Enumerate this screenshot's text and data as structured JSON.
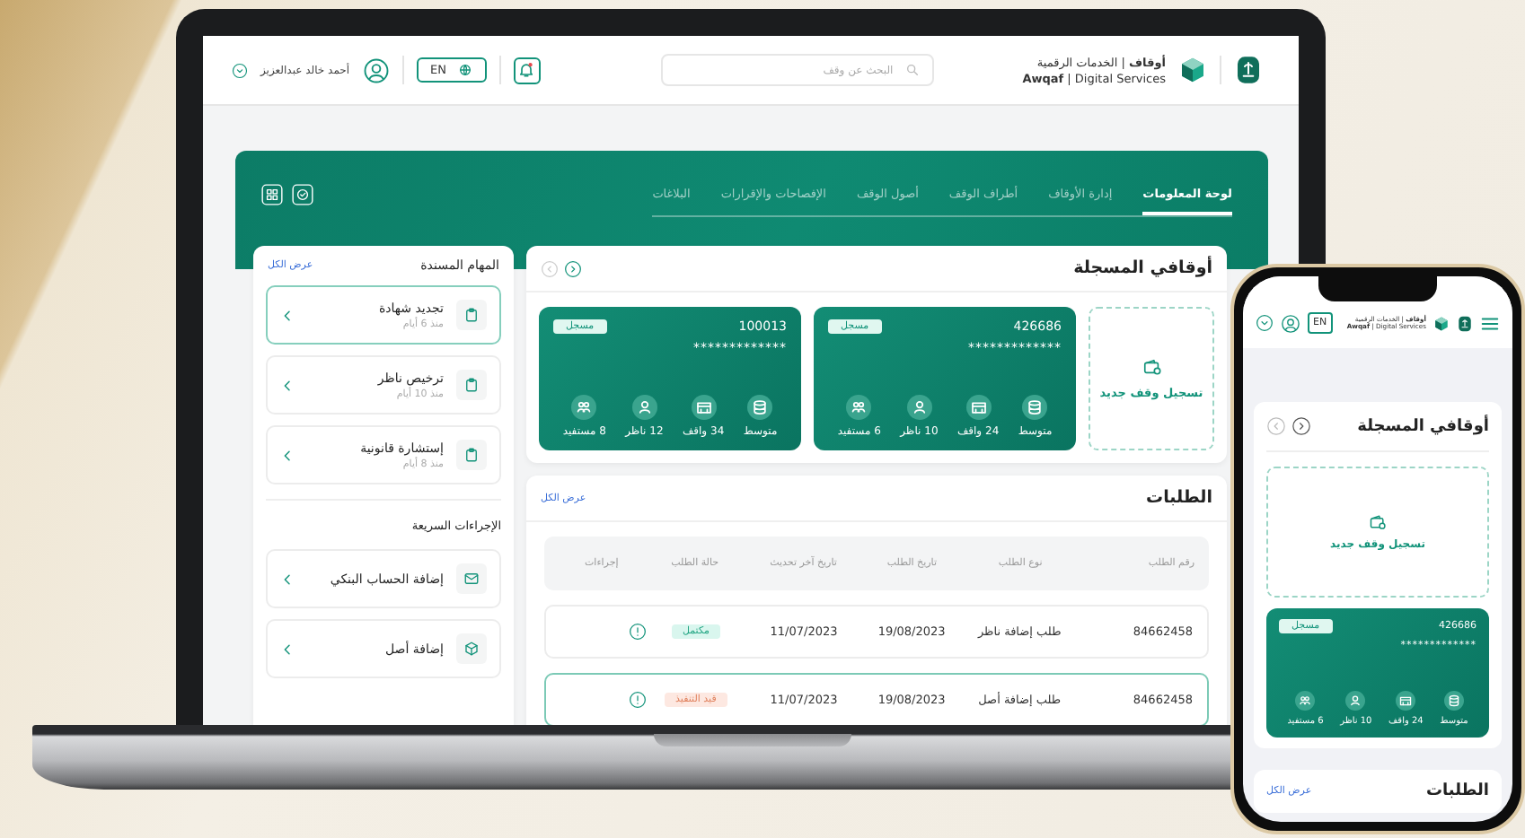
{
  "laptop": {
    "header": {
      "brand_ar": "**أوقاف** | الخدمات الرقمية",
      "brand_en": "**Awqaf** | Digital Services",
      "search": {
        "placeholder": "البحث عن وقف"
      },
      "language": "EN",
      "user_name": "أحمد خالد عبدالعزيز"
    },
    "tabs": [
      {
        "label": "لوحة المعلومات",
        "selected": true
      },
      {
        "label": "إدارة الأوقاف",
        "selected": false
      },
      {
        "label": "أطراف الوقف",
        "selected": false
      },
      {
        "label": "أصول الوقف",
        "selected": false
      },
      {
        "label": "الإفصاحات والإقرارات",
        "selected": false
      },
      {
        "label": "البلاغات",
        "selected": false
      }
    ],
    "endowments": {
      "title": "أوقافي المسجلة",
      "register_label": "تسجيل وقف جديد",
      "cards": [
        {
          "number": "426686",
          "masked": "*************",
          "badge": "مسجل",
          "stats": [
            "متوسط",
            "24 واقف",
            "10 ناظر",
            "6 مستفيد"
          ]
        },
        {
          "number": "100013",
          "masked": "*************",
          "badge": "مسجل",
          "stats": [
            "متوسط",
            "34 واقف",
            "12 ناظر",
            "8 مستفيد"
          ]
        }
      ]
    },
    "requests": {
      "title": "الطلبات",
      "view_all": "عرض الكل",
      "columns": [
        "رقم الطلب",
        "نوع الطلب",
        "تاريخ الطلب",
        "تاريخ آخر تحديث",
        "حالة الطلب",
        "إجراءات"
      ],
      "rows": [
        {
          "cells": [
            "84662458",
            "طلب إضافة ناظر",
            "19/08/2023",
            "11/07/2023"
          ],
          "status": {
            "label": "مكتمل",
            "kind": "complete"
          },
          "selected": false
        },
        {
          "cells": [
            "84662458",
            "طلب إضافة أصل",
            "19/08/2023",
            "11/07/2023"
          ],
          "status": {
            "label": "قيد التنفيذ",
            "kind": "pending"
          },
          "selected": true
        }
      ]
    },
    "tasks": {
      "title": "المهام المسندة",
      "view_all": "عرض الكل",
      "items": [
        {
          "title": "تجديد شهادة",
          "age": "منذ 6 أيام",
          "selected": true
        },
        {
          "title": "ترخيص ناظر",
          "age": "منذ 10 أيام",
          "selected": false
        },
        {
          "title": "إستشارة قانونية",
          "age": "منذ 8 أيام",
          "selected": false
        }
      ]
    },
    "quick_actions": {
      "title": "الإجراءات السريعة",
      "items": [
        {
          "label": "إضافة الحساب البنكي",
          "kind": "mail"
        },
        {
          "label": "إضافة أصل",
          "kind": "cube"
        }
      ]
    }
  },
  "phone": {
    "header": {
      "brand_ar": "**أوقاف** | الخدمات الرقمية",
      "brand_en": "**Awqaf** | Digital Services",
      "language": "EN"
    },
    "endowments": {
      "title": "أوقافي المسجلة",
      "register_label": "تسجيل وقف جديد",
      "card": {
        "number": "426686",
        "masked": "*************",
        "badge": "مسجل",
        "stats": [
          "متوسط",
          "24 واقف",
          "10 ناظر",
          "6 مستفيد"
        ]
      }
    },
    "requests": {
      "title": "الطلبات",
      "view_all": "عرض الكل"
    }
  }
}
